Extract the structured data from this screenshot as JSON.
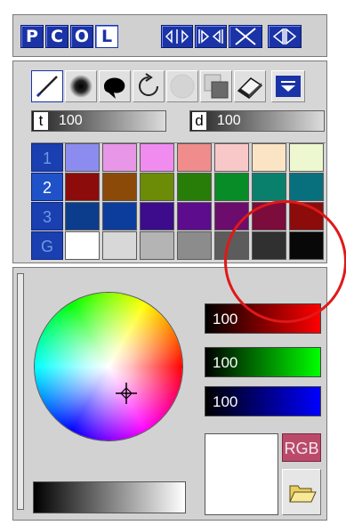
{
  "modebar": {
    "mode_buttons": [
      "P",
      "C",
      "O",
      "L"
    ],
    "selected_mode": "L",
    "tool_buttons": [
      "expand-icon",
      "collapse-icon",
      "close-icon",
      "flip-icon"
    ]
  },
  "palette": {
    "tools": [
      {
        "icon": "pen-icon",
        "selected": true
      },
      {
        "icon": "airbrush-icon",
        "selected": false
      },
      {
        "icon": "lasso-fill-icon",
        "selected": false
      },
      {
        "icon": "rotate-icon",
        "selected": false
      },
      {
        "icon": "blur-icon",
        "selected": false
      },
      {
        "icon": "copy-icon",
        "selected": false
      },
      {
        "icon": "eraser-icon",
        "selected": false
      },
      {
        "icon": "menu-down-icon",
        "selected": false
      }
    ],
    "sliders": [
      {
        "key": "t",
        "value": "100"
      },
      {
        "key": "d",
        "value": "100"
      }
    ],
    "rows": [
      {
        "label": "1",
        "colors": [
          "#8c8cf0",
          "#e896e8",
          "#f08cf0",
          "#f08c8c",
          "#f8c8c8",
          "#fae4c4",
          "#eef8d0"
        ]
      },
      {
        "label": "2",
        "colors": [
          "#8c0c0c",
          "#8c4a08",
          "#6c8c08",
          "#287c08",
          "#088c28",
          "#08806c",
          "#08707c"
        ]
      },
      {
        "label": "3",
        "colors": [
          "#0c3c8c",
          "#0c3c9c",
          "#3c0c8c",
          "#5c0c8c",
          "#6c0c6c",
          "#7c0c3c",
          "#8c0c0c"
        ]
      },
      {
        "label": "G",
        "colors": [
          "#ffffff",
          "#d8d8d8",
          "#b4b4b4",
          "#8c8c8c",
          "#5c5c5c",
          "#303030",
          "#080808"
        ]
      }
    ],
    "selected_row": "2"
  },
  "picker": {
    "channels": [
      {
        "name": "red",
        "value": "100"
      },
      {
        "name": "green",
        "value": "100"
      },
      {
        "name": "blue",
        "value": "100"
      }
    ],
    "mode_label": "RGB",
    "preview_color": "#ffffff"
  },
  "annotation": {
    "color": "#e01818"
  }
}
